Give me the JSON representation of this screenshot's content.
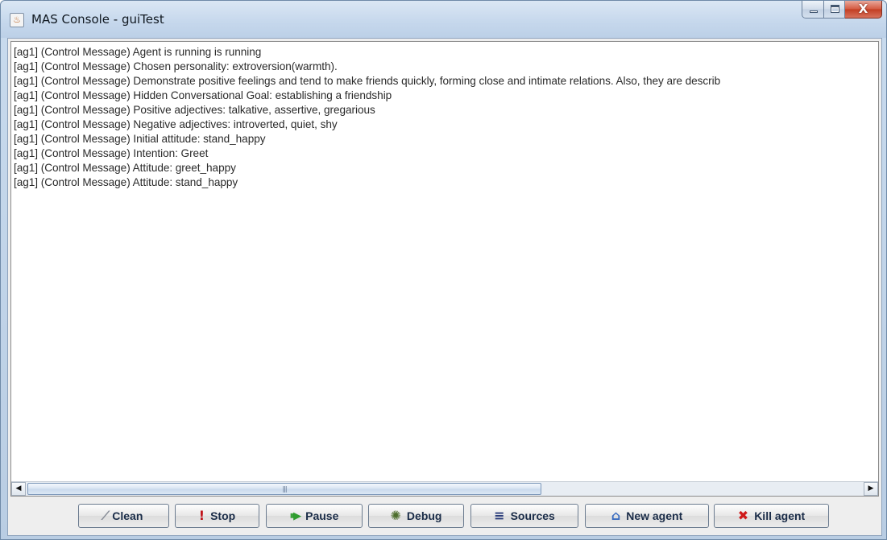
{
  "window": {
    "title": "MAS Console - guiTest",
    "controls": {
      "minimize_icon": "minimize-icon",
      "maximize_icon": "maximize-icon",
      "close_icon": "close-icon"
    }
  },
  "console": {
    "lines": [
      "[ag1] (Control Message) Agent is running is running",
      "[ag1] (Control Message) Chosen personality: extroversion(warmth).",
      "[ag1] (Control Message) Demonstrate positive feelings and tend to make friends quickly, forming close and intimate relations. Also, they are describ",
      "[ag1] (Control Message) Hidden Conversational Goal: establishing a friendship",
      "[ag1] (Control Message) Positive adjectives: talkative, assertive, gregarious",
      "[ag1] (Control Message) Negative adjectives: introverted, quiet, shy",
      "[ag1] (Control Message) Initial attitude: stand_happy",
      "[ag1] (Control Message) Intention: Greet",
      "[ag1] (Control Message) Attitude: greet_happy",
      "[ag1] (Control Message) Attitude: stand_happy"
    ]
  },
  "toolbar": {
    "clean": {
      "label": "Clean",
      "icon": "eraser-icon",
      "glyph": "⁄"
    },
    "stop": {
      "label": "Stop",
      "icon": "exclamation-icon",
      "glyph": "!"
    },
    "pause": {
      "label": "Pause",
      "icon": "pause-play-icon",
      "glyph": "⏸▶"
    },
    "debug": {
      "label": "Debug",
      "icon": "bug-icon",
      "glyph": "✺"
    },
    "sources": {
      "label": "Sources",
      "icon": "list-icon",
      "glyph": "≡"
    },
    "new_agent": {
      "label": "New agent",
      "icon": "new-agent-icon",
      "glyph": "⌂"
    },
    "kill_agent": {
      "label": "Kill agent",
      "icon": "red-x-icon",
      "glyph": "✖"
    }
  },
  "colors": {
    "titlebar": "#c5d7ec",
    "console_bg": "#ffffff",
    "close_button": "#c23d22",
    "button_text": "#1a2c48"
  }
}
